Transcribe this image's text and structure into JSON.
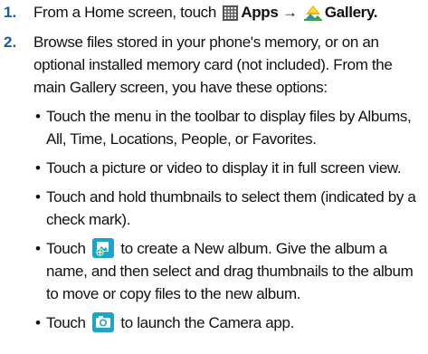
{
  "steps": [
    {
      "number": "1.",
      "prefix": "From a Home screen, touch",
      "apps_label": "Apps",
      "arrow": "→",
      "gallery_label": "Gallery",
      "suffix": "."
    },
    {
      "number": "2.",
      "text": "Browse files stored in your phone's memory, or on an optional installed memory card (not included). From the main Gallery screen, you have these options:",
      "bullets": [
        {
          "text": "Touch the menu in the toolbar to display files by Albums, All, Time, Locations, People, or Favorites."
        },
        {
          "text": "Touch a picture or video to display it in full screen view."
        },
        {
          "text": "Touch and hold thumbnails to select them (indicated by a check mark)."
        },
        {
          "before": "Touch",
          "after": "to create a New album. Give the album a name, and then select and drag thumbnails to the album to move or copy files to the new album.",
          "icon": "new-album-icon"
        },
        {
          "before": "Touch",
          "after": "to launch the Camera app.",
          "icon": "camera-icon"
        }
      ]
    }
  ],
  "bullet_char": "•",
  "colors": {
    "step_number": "#1a5aa8",
    "icon_teal": "#1fa3c9",
    "apps_icon": "#555555",
    "gallery_yellow": "#f5b400"
  }
}
